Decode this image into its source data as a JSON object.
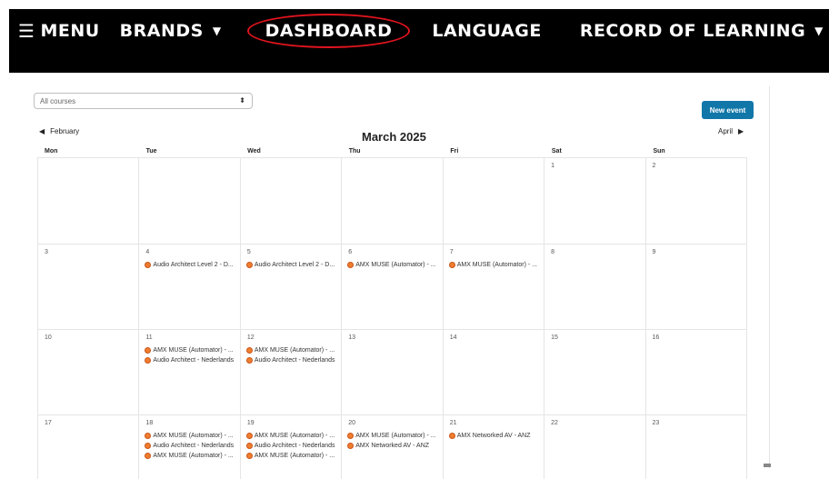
{
  "nav": {
    "menu": "MENU",
    "brands": "BRANDS",
    "dashboard": "DASHBOARD",
    "language": "LANGUAGE",
    "record": "RECORD OF LEARNING"
  },
  "filter": {
    "selected": "All courses"
  },
  "buttons": {
    "new_event": "New event"
  },
  "calendar": {
    "title": "March 2025",
    "prev": "February",
    "next": "April",
    "headers": [
      "Mon",
      "Tue",
      "Wed",
      "Thu",
      "Fri",
      "Sat",
      "Sun"
    ],
    "weeks": [
      [
        {
          "day": "",
          "events": []
        },
        {
          "day": "",
          "events": []
        },
        {
          "day": "",
          "events": []
        },
        {
          "day": "",
          "events": []
        },
        {
          "day": "",
          "events": []
        },
        {
          "day": "1",
          "events": []
        },
        {
          "day": "2",
          "events": []
        }
      ],
      [
        {
          "day": "3",
          "events": []
        },
        {
          "day": "4",
          "events": [
            "Audio Architect Level 2 - D..."
          ]
        },
        {
          "day": "5",
          "events": [
            "Audio Architect Level 2 - D..."
          ]
        },
        {
          "day": "6",
          "events": [
            "AMX MUSE (Automator) - ..."
          ]
        },
        {
          "day": "7",
          "events": [
            "AMX MUSE (Automator) - ..."
          ]
        },
        {
          "day": "8",
          "events": []
        },
        {
          "day": "9",
          "events": []
        }
      ],
      [
        {
          "day": "10",
          "events": []
        },
        {
          "day": "11",
          "events": [
            "AMX MUSE (Automator) - ...",
            "Audio Architect - Nederlands"
          ]
        },
        {
          "day": "12",
          "events": [
            "AMX MUSE (Automator) - ...",
            "Audio Architect - Nederlands"
          ]
        },
        {
          "day": "13",
          "events": []
        },
        {
          "day": "14",
          "events": []
        },
        {
          "day": "15",
          "events": []
        },
        {
          "day": "16",
          "events": []
        }
      ],
      [
        {
          "day": "17",
          "events": []
        },
        {
          "day": "18",
          "events": [
            "AMX MUSE (Automator) - ...",
            "Audio Architect - Nederlands",
            "AMX MUSE (Automator) - ..."
          ]
        },
        {
          "day": "19",
          "events": [
            "AMX MUSE (Automator) - ...",
            "Audio Architect - Nederlands",
            "AMX MUSE (Automator) - ..."
          ]
        },
        {
          "day": "20",
          "events": [
            "AMX MUSE (Automator) - ...",
            "AMX Networked AV - ANZ"
          ]
        },
        {
          "day": "21",
          "events": [
            "AMX Networked AV - ANZ"
          ]
        },
        {
          "day": "22",
          "events": []
        },
        {
          "day": "23",
          "events": []
        }
      ]
    ]
  }
}
